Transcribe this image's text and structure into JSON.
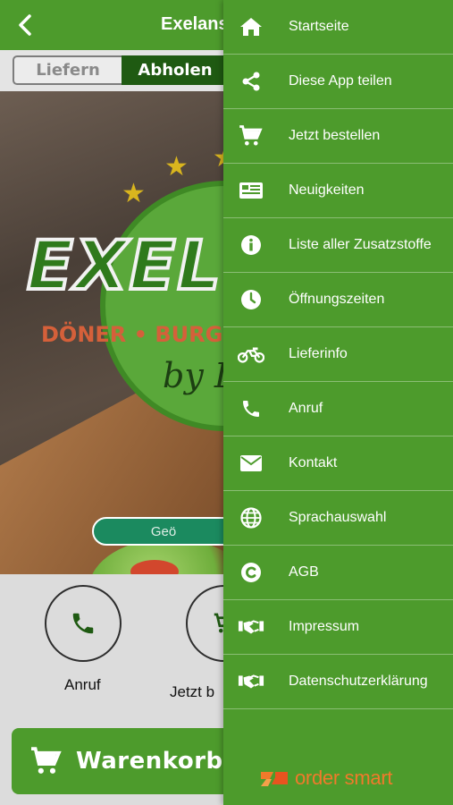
{
  "header": {
    "title": "Exelans"
  },
  "toggle": {
    "delivery": "Liefern",
    "pickup": "Abholen"
  },
  "hero": {
    "brand": "EXEL",
    "subtitle": "DÖNER • BURGER",
    "script": "by D",
    "status": "Geö"
  },
  "actions": {
    "call": "Anruf",
    "order": "Jetzt b"
  },
  "cart": {
    "label": "Warenkorb"
  },
  "drawer": {
    "items": [
      {
        "label": "Startseite",
        "icon": "home-icon"
      },
      {
        "label": "Diese App teilen",
        "icon": "share-icon"
      },
      {
        "label": "Jetzt bestellen",
        "icon": "cart-icon"
      },
      {
        "label": "Neuigkeiten",
        "icon": "news-icon"
      },
      {
        "label": "Liste aller Zusatzstoffe",
        "icon": "info-icon"
      },
      {
        "label": "Öffnungszeiten",
        "icon": "clock-icon"
      },
      {
        "label": "Lieferinfo",
        "icon": "motorcycle-icon"
      },
      {
        "label": "Anruf",
        "icon": "phone-icon"
      },
      {
        "label": "Kontakt",
        "icon": "envelope-icon"
      },
      {
        "label": "Sprachauswahl",
        "icon": "globe-icon"
      },
      {
        "label": "AGB",
        "icon": "copyright-icon"
      },
      {
        "label": "Impressum",
        "icon": "handshake-icon"
      },
      {
        "label": "Datenschutzerklärung",
        "icon": "handshake-icon"
      }
    ],
    "brand": "order smart"
  },
  "colors": {
    "primary": "#4d9b2c",
    "dark_green": "#1f5a12",
    "status_green": "#1b8a5f",
    "brand_orange": "#f07a2b"
  }
}
